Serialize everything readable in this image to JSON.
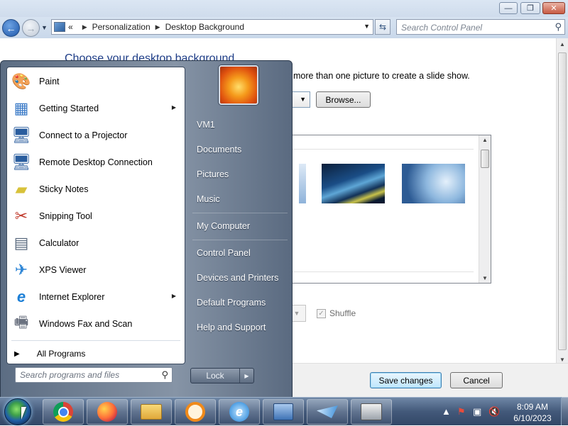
{
  "window": {
    "controls": {
      "minimize": "—",
      "maximize": "❐",
      "close": "✕"
    },
    "address": {
      "chevrons": "«",
      "crumbs": [
        "Personalization",
        "Desktop Background"
      ]
    },
    "search_placeholder": "Search Control Panel"
  },
  "page": {
    "title": "Choose your desktop background",
    "description": "more than one picture to create a slide show.",
    "browse_label": "Browse...",
    "shuffle_label": "Shuffle",
    "save_label": "Save changes",
    "cancel_label": "Cancel"
  },
  "start_menu": {
    "programs": [
      {
        "label": "Paint",
        "icon": "paint-icon",
        "submenu": false
      },
      {
        "label": "Getting Started",
        "icon": "getting-started-icon",
        "submenu": true
      },
      {
        "label": "Connect to a Projector",
        "icon": "projector-icon",
        "submenu": false
      },
      {
        "label": "Remote Desktop Connection",
        "icon": "remote-desktop-icon",
        "submenu": false
      },
      {
        "label": "Sticky Notes",
        "icon": "sticky-notes-icon",
        "submenu": false
      },
      {
        "label": "Snipping Tool",
        "icon": "snipping-tool-icon",
        "submenu": false
      },
      {
        "label": "Calculator",
        "icon": "calculator-icon",
        "submenu": false
      },
      {
        "label": "XPS Viewer",
        "icon": "xps-viewer-icon",
        "submenu": false
      },
      {
        "label": "Internet Explorer",
        "icon": "internet-explorer-icon",
        "submenu": true
      },
      {
        "label": "Windows Fax and Scan",
        "icon": "fax-scan-icon",
        "submenu": false
      }
    ],
    "all_programs": "All Programs",
    "search_placeholder": "Search programs and files",
    "right_items": [
      "VM1",
      "Documents",
      "Pictures",
      "Music",
      "My Computer",
      "Control Panel",
      "Devices and Printers",
      "Default Programs",
      "Help and Support"
    ],
    "lock_label": "Lock"
  },
  "taskbar": {
    "pinned": [
      "start-orb",
      "chrome-icon",
      "firefox-icon",
      "file-explorer-icon",
      "magnifier-icon",
      "internet-explorer-icon",
      "remote-desktop-icon",
      "xps-viewer-icon",
      "fax-scan-icon"
    ],
    "clock": {
      "time": "8:09 AM",
      "date": "6/10/2023"
    }
  },
  "colors": {
    "title_blue": "#1e3d87",
    "taskbar": "#43597a",
    "start_menu": "#6f7e92"
  }
}
